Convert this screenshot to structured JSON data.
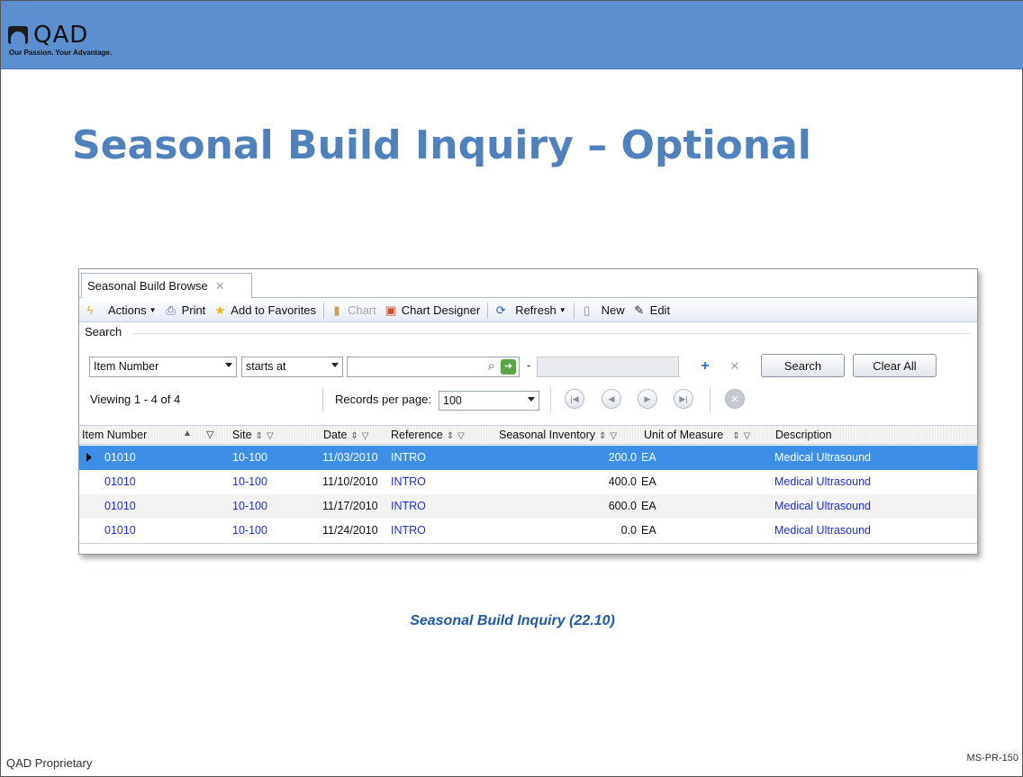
{
  "brand": {
    "logo_text": "QAD",
    "tagline": "Our Passion. Your Advantage."
  },
  "page_title": "Seasonal Build Inquiry – Optional",
  "window": {
    "tab_label": "Seasonal Build Browse",
    "tab_close": "✕",
    "toolbar": {
      "actions": "Actions",
      "print": "Print",
      "add_to_favorites": "Add to Favorites",
      "chart": "Chart",
      "chart_designer": "Chart Designer",
      "refresh": "Refresh",
      "new": "New",
      "edit": "Edit"
    },
    "search": {
      "label": "Search",
      "field_select": "Item Number",
      "operator_select": "starts at",
      "value": "",
      "to_value": "",
      "dash": "-",
      "search_button": "Search",
      "clear_button": "Clear All"
    },
    "paging": {
      "viewing": "Viewing 1 - 4  of  4",
      "records_per_page_label": "Records per page:",
      "records_per_page": "100"
    },
    "grid": {
      "columns": [
        "Item Number",
        "Site",
        "Date",
        "Reference",
        "Seasonal Inventory",
        "Unit of Measure",
        "Description"
      ],
      "rows": [
        {
          "item": "01010",
          "site": "10-100",
          "date": "11/03/2010",
          "reference": "INTRO",
          "inventory": "200.0",
          "uom": "EA",
          "description": "Medical Ultrasound"
        },
        {
          "item": "01010",
          "site": "10-100",
          "date": "11/10/2010",
          "reference": "INTRO",
          "inventory": "400.0",
          "uom": "EA",
          "description": "Medical Ultrasound"
        },
        {
          "item": "01010",
          "site": "10-100",
          "date": "11/17/2010",
          "reference": "INTRO",
          "inventory": "600.0",
          "uom": "EA",
          "description": "Medical Ultrasound"
        },
        {
          "item": "01010",
          "site": "10-100",
          "date": "11/24/2010",
          "reference": "INTRO",
          "inventory": "0.0",
          "uom": "EA",
          "description": "Medical Ultrasound"
        }
      ],
      "selected_row": 0
    }
  },
  "caption": "Seasonal Build Inquiry (22.10)",
  "footer": {
    "left": "QAD Proprietary",
    "right": "MS-PR-150"
  },
  "colors": {
    "header_band": "#5b8fd0",
    "title": "#4f81bd",
    "selection": "#3d8ee6",
    "link": "#1f2fcf",
    "caption": "#1f5aa6"
  }
}
